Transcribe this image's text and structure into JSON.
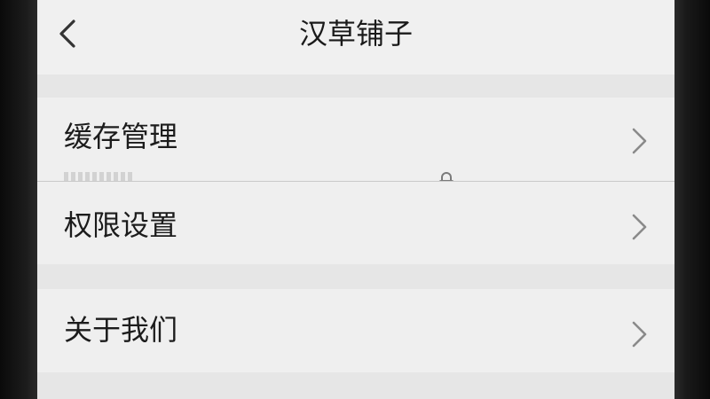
{
  "navbar": {
    "title": "汉草铺子",
    "back_icon": "chevron-left-icon"
  },
  "settings": {
    "items": [
      {
        "label": "缓存管理",
        "icon": "chevron-right-icon"
      },
      {
        "label": "权限设置",
        "icon": "chevron-right-icon"
      },
      {
        "label": "关于我们",
        "icon": "chevron-right-icon"
      }
    ]
  },
  "colors": {
    "background": "#ececec",
    "row": "#efefef",
    "text": "#1c1c1c",
    "chevron": "#8a8a8a"
  }
}
